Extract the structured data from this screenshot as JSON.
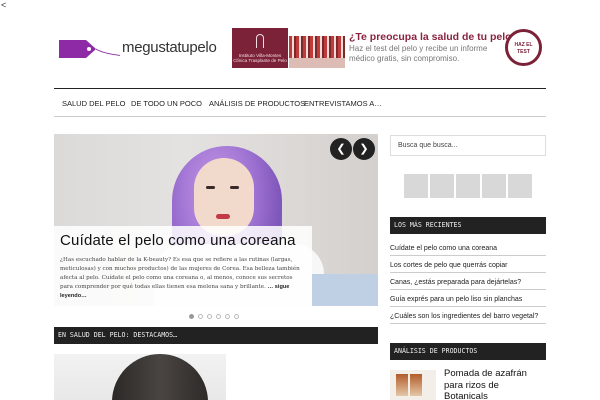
{
  "corner_glyph": "<",
  "logo": {
    "text": "megustatupelo",
    "accent": "#8e2aa6"
  },
  "ad": {
    "brand": "Instituto Villa-Montes Clínica Trasplante de Pelo",
    "title": "¿Te preocupa la salud de tu pelo?",
    "body": "Haz el test del pelo y recibe un informe médico gratis, sin compromiso.",
    "badge": "HAZ EL TEST",
    "accent": "#7b2238"
  },
  "nav": {
    "items": [
      "SALUD DEL PELO",
      "DE TODO UN POCO",
      "ANÁLISIS DE PRODUCTOS",
      "ENTREVISTAMOS A…"
    ]
  },
  "slider": {
    "prev_icon": "chevron-left-icon",
    "next_icon": "chevron-right-icon",
    "prev_glyph": "❮",
    "next_glyph": "❯",
    "title": "Cuídate el pelo como una coreana",
    "excerpt": "¿Has escuchado hablar de la K-beauty? Es esa que se refiere a las rutinas (largas, meticulosas) y con muchos productos) de las mujeres de Corea. Esa belleza también afecta al pelo. Cuídate el pelo como una coreana o, al menos, conoce sus secretos para comprender por qué todas ellas tienen esa melena sana y brillante.",
    "more": "… sigue leyendo…",
    "slide_count": 6,
    "active_index": 0
  },
  "section_featured": {
    "label": "EN SALUD DEL PELO: DESTACAMOS…"
  },
  "sidebar": {
    "search_placeholder": "Busca que busca...",
    "recent_heading": "LOS MÁS RECIENTES",
    "recent": [
      "Cuídate el pelo como una coreana",
      "Los cortes de pelo que querrás copiar",
      "Canas, ¿estás preparada para dejártelas?",
      "Guía exprés para un pelo liso sin planchas",
      "¿Cuáles son los ingredientes del barro vegetal?"
    ],
    "analysis_heading": "ANÁLISIS DE PRODUCTOS",
    "product_title": "Pomada de azafrán para rizos de Botanicals"
  }
}
